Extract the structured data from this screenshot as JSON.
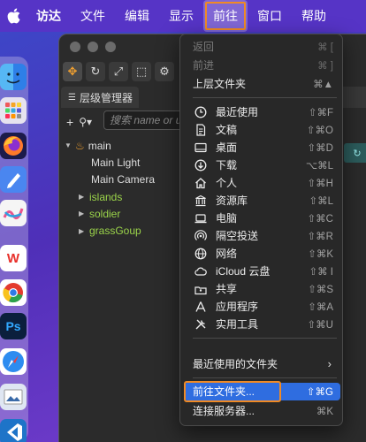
{
  "menubar": {
    "apple_icon": "apple-icon",
    "items": [
      "访达",
      "文件",
      "编辑",
      "显示",
      "前往",
      "窗口",
      "帮助"
    ]
  },
  "dock": [
    {
      "icon": "finder-icon",
      "color": "#3b8ff0"
    },
    {
      "icon": "launchpad-icon",
      "color": "#e9e9ef"
    },
    {
      "icon": "firefox-icon",
      "color": "#2a2a6a"
    },
    {
      "icon": "freeform-icon",
      "color": "#4b8df4"
    },
    {
      "icon": "freeform-board-icon",
      "color": "#f5f5f5"
    },
    {
      "icon": "wps-icon",
      "color": "#ffffff",
      "label": "W"
    },
    {
      "icon": "chrome-icon",
      "color": "#ffffff"
    },
    {
      "icon": "photoshop-icon",
      "color": "#0b1f3d",
      "label": "Ps"
    },
    {
      "icon": "safari-icon",
      "color": "#2d8cf0"
    },
    {
      "icon": "preview-icon",
      "color": "#cfd8e8"
    },
    {
      "icon": "vscode-icon",
      "color": "#1e74c8"
    }
  ],
  "window": {
    "panel_tab": "层级管理器",
    "search_placeholder": "搜索 name or uu",
    "tree": [
      {
        "label": "main",
        "level": 0,
        "expanded": true,
        "color": "#dddddd"
      },
      {
        "label": "Main Light",
        "level": 1,
        "expanded": null,
        "color": "#dddddd"
      },
      {
        "label": "Main Camera",
        "level": 1,
        "expanded": null,
        "color": "#dddddd"
      },
      {
        "label": "islands",
        "level": 1,
        "expanded": false,
        "color": "#9bd44a"
      },
      {
        "label": "soldier",
        "level": 1,
        "expanded": false,
        "color": "#9bd44a"
      },
      {
        "label": "grassGoup",
        "level": 1,
        "expanded": false,
        "color": "#9bd44a"
      }
    ]
  },
  "go_menu": {
    "items": [
      {
        "label": "返回",
        "shortcut": "⌘ [",
        "disabled": true,
        "icon": ""
      },
      {
        "label": "前进",
        "shortcut": "⌘ ]",
        "disabled": true,
        "icon": ""
      },
      {
        "label": "上层文件夹",
        "shortcut": "⌘▲",
        "disabled": false,
        "icon": ""
      },
      {
        "label": "最近使用",
        "shortcut": "⇧⌘F",
        "disabled": false,
        "icon": "recents-icon"
      },
      {
        "label": "文稿",
        "shortcut": "⇧⌘O",
        "disabled": false,
        "icon": "documents-icon"
      },
      {
        "label": "桌面",
        "shortcut": "⇧⌘D",
        "disabled": false,
        "icon": "desktop-icon"
      },
      {
        "label": "下载",
        "shortcut": "⌥⌘L",
        "disabled": false,
        "icon": "downloads-icon"
      },
      {
        "label": "个人",
        "shortcut": "⇧⌘H",
        "disabled": false,
        "icon": "home-icon"
      },
      {
        "label": "资源库",
        "shortcut": "⇧⌘L",
        "disabled": false,
        "icon": "library-icon"
      },
      {
        "label": "电脑",
        "shortcut": "⇧⌘C",
        "disabled": false,
        "icon": "computer-icon"
      },
      {
        "label": "隔空投送",
        "shortcut": "⇧⌘R",
        "disabled": false,
        "icon": "airdrop-icon"
      },
      {
        "label": "网络",
        "shortcut": "⇧⌘K",
        "disabled": false,
        "icon": "network-icon"
      },
      {
        "label": "iCloud 云盘",
        "shortcut": "⇧⌘ I",
        "disabled": false,
        "icon": "icloud-icon"
      },
      {
        "label": "共享",
        "shortcut": "⇧⌘S",
        "disabled": false,
        "icon": "shared-icon"
      },
      {
        "label": "应用程序",
        "shortcut": "⇧⌘A",
        "disabled": false,
        "icon": "applications-icon"
      },
      {
        "label": "实用工具",
        "shortcut": "⇧⌘U",
        "disabled": false,
        "icon": "utilities-icon"
      },
      {
        "label": "最近使用的文件夹",
        "shortcut": "",
        "disabled": false,
        "icon": ""
      },
      {
        "label": "前往文件夹...",
        "shortcut": "⇧⌘G",
        "disabled": false,
        "icon": "",
        "highlighted": true
      },
      {
        "label": "连接服务器...",
        "shortcut": "⌘K",
        "disabled": false,
        "icon": ""
      }
    ]
  },
  "colors": {
    "highlight": "#2f6de0",
    "annotation_outline": "#f08a24",
    "menubar": "#5634c6"
  }
}
